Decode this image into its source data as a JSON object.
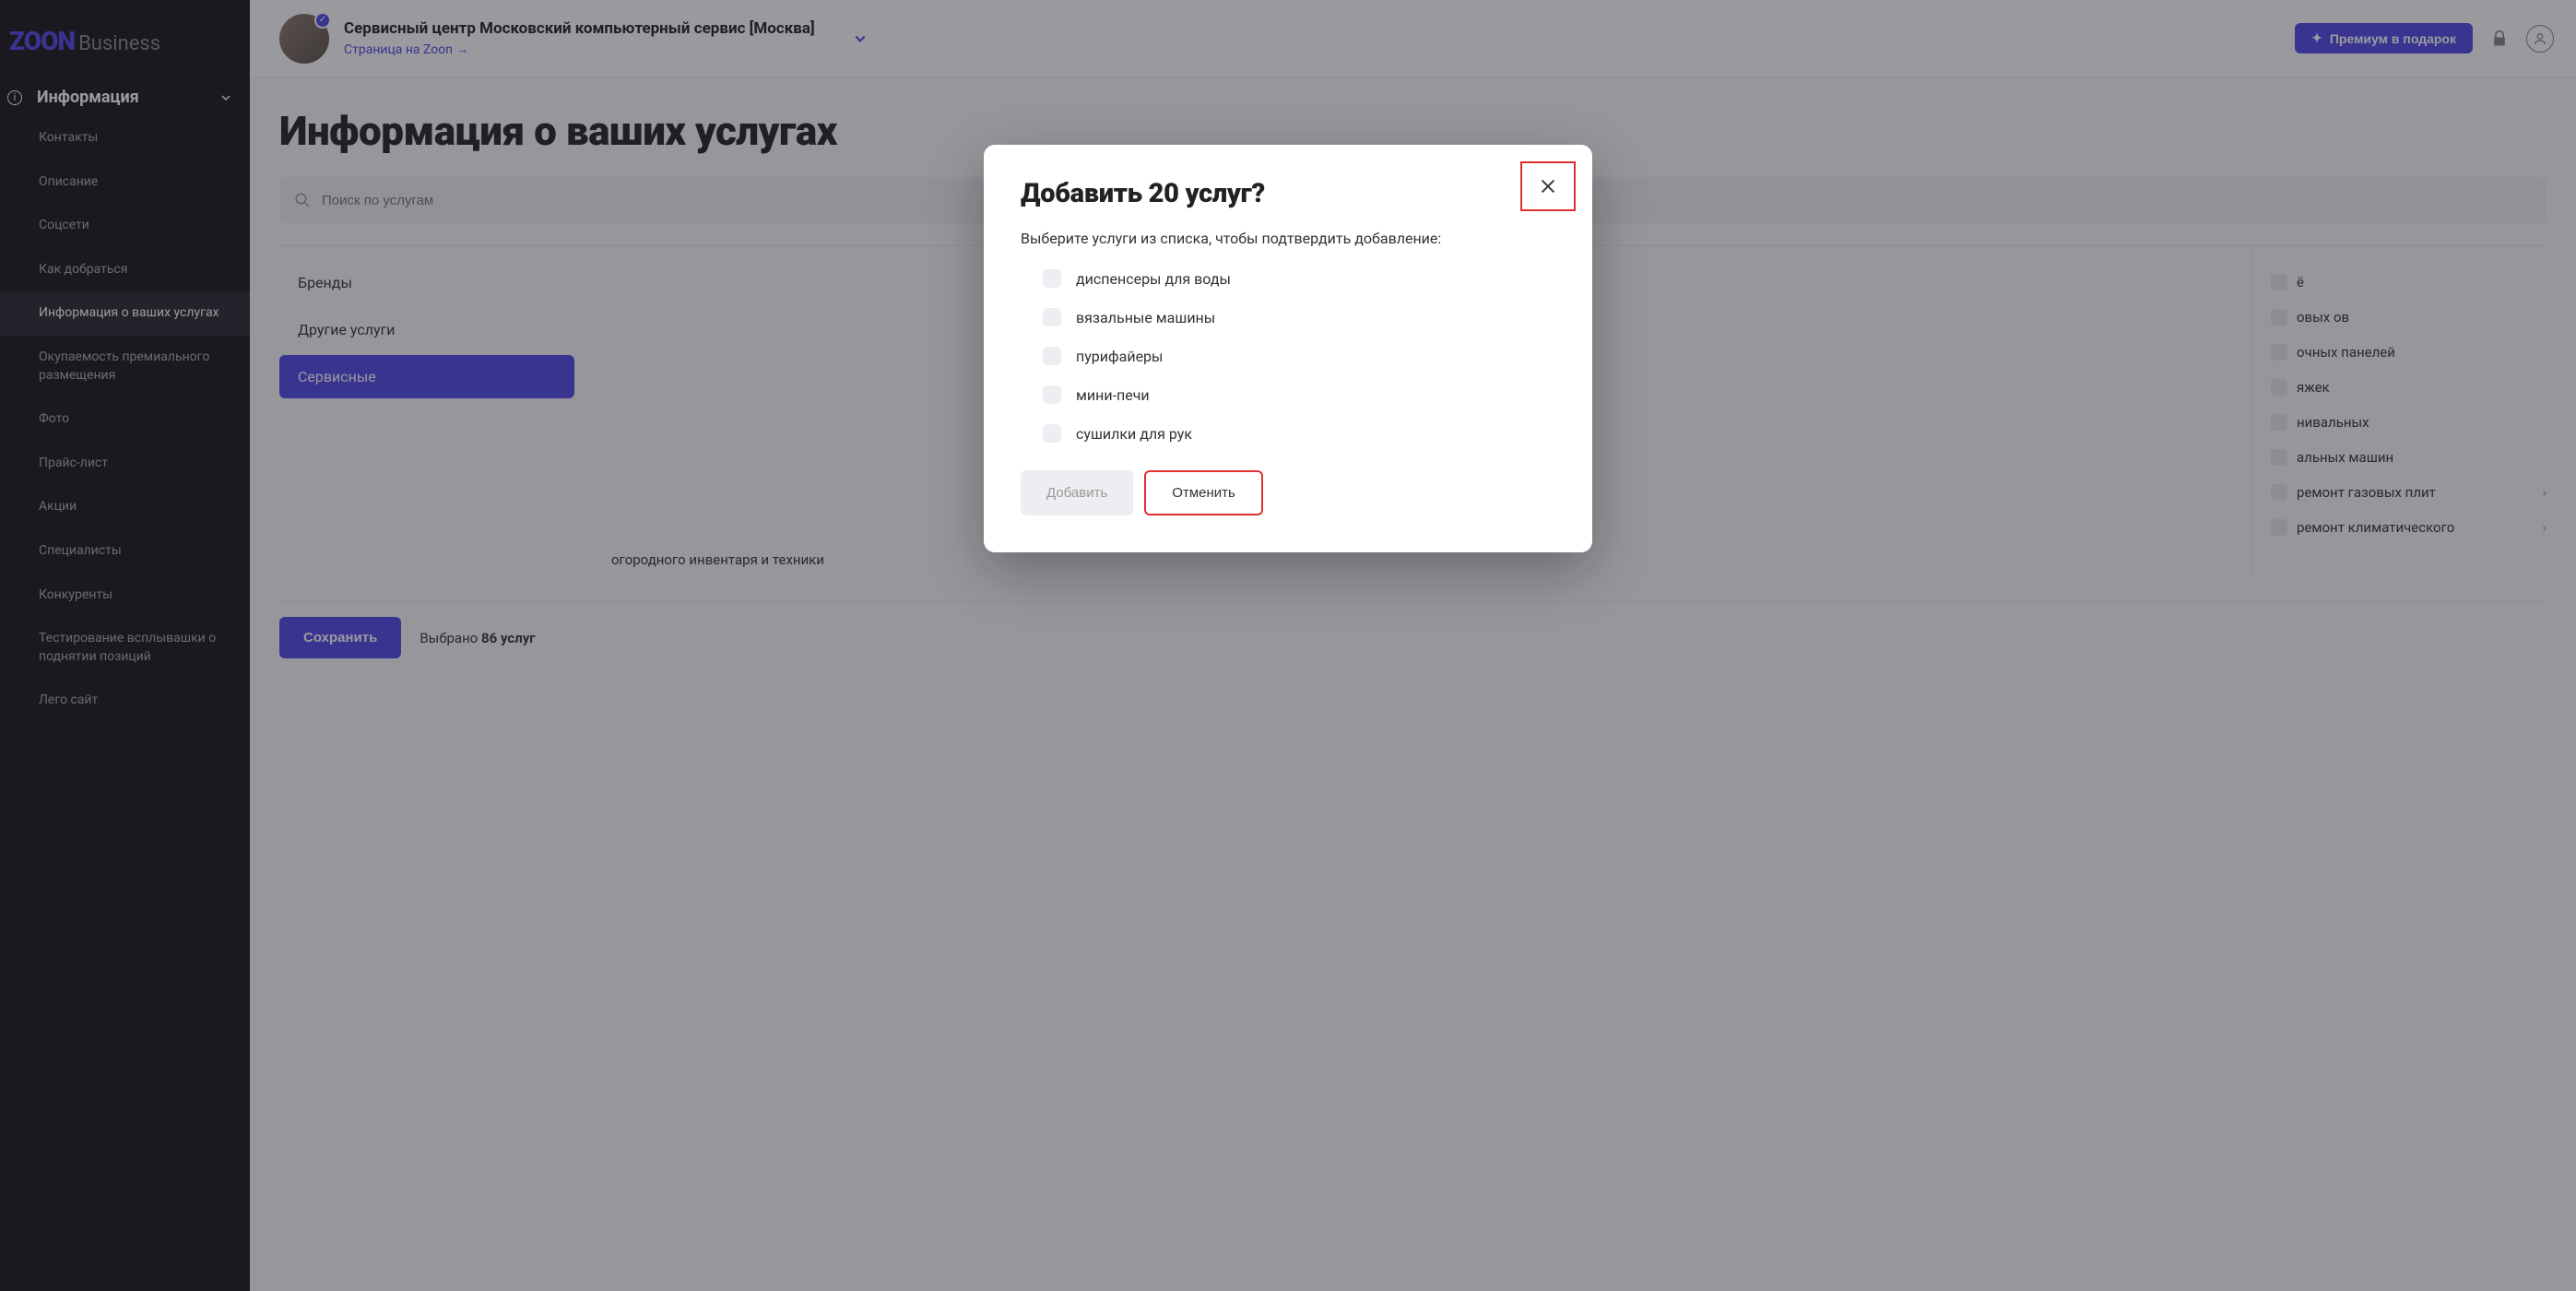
{
  "logo": {
    "brand": "ZOON",
    "suffix": "Business"
  },
  "sidebar": {
    "section_title": "Информация",
    "items": [
      {
        "label": "Контакты"
      },
      {
        "label": "Описание"
      },
      {
        "label": "Соцсети"
      },
      {
        "label": "Как добраться"
      },
      {
        "label": "Информация о ваших услугах",
        "active": true
      },
      {
        "label": "Окупаемость премиального размещения"
      },
      {
        "label": "Фото"
      },
      {
        "label": "Прайс-лист"
      },
      {
        "label": "Акции"
      },
      {
        "label": "Специалисты"
      },
      {
        "label": "Конкуренты"
      },
      {
        "label": "Тестирование всплывашки о поднятии позиций"
      },
      {
        "label": "Лего сайт"
      }
    ]
  },
  "topbar": {
    "org_name": "Сервисный центр Московский компьютерный сервис [Москва]",
    "org_link": "Страница на Zoon →",
    "premium_label": "Премиум в подарок"
  },
  "page": {
    "title": "Информация о ваших услугах",
    "search_placeholder": "Поиск по услугам",
    "categories": [
      {
        "label": "Бренды"
      },
      {
        "label": "Другие услуги"
      },
      {
        "label": "Сервисные",
        "active": true
      }
    ],
    "right_items": [
      {
        "label": "ё"
      },
      {
        "label": "овых ов"
      },
      {
        "label": "очных панелей"
      },
      {
        "label": "яжек"
      },
      {
        "label": "нивальных"
      },
      {
        "label": "альных машин"
      },
      {
        "label": "ремонт газовых плит"
      },
      {
        "label": "ремонт климатического"
      }
    ],
    "mid_items": [
      {
        "label": "огородного инвентаря и техники"
      }
    ],
    "save_label": "Сохранить",
    "selected_prefix": "Выбрано ",
    "selected_count": "86 услуг"
  },
  "modal": {
    "title": "Добавить 20 услуг?",
    "subtitle": "Выберите услуги из списка, чтобы подтвердить добавление:",
    "items": [
      {
        "label": "диспенсеры для воды"
      },
      {
        "label": "вязальные машины"
      },
      {
        "label": "пурифайеры"
      },
      {
        "label": "мини-печи"
      },
      {
        "label": "сушилки для рук"
      }
    ],
    "add_label": "Добавить",
    "cancel_label": "Отменить"
  }
}
